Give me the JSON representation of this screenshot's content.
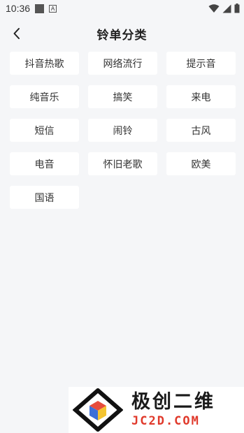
{
  "status": {
    "time": "10:36",
    "badge_letter": "A"
  },
  "header": {
    "title": "铃单分类",
    "back_icon": "chevron-left-icon"
  },
  "categories": [
    {
      "label": "抖音热歌"
    },
    {
      "label": "网络流行"
    },
    {
      "label": "提示音"
    },
    {
      "label": "纯音乐"
    },
    {
      "label": "搞笑"
    },
    {
      "label": "来电"
    },
    {
      "label": "短信"
    },
    {
      "label": "闹铃"
    },
    {
      "label": "古风"
    },
    {
      "label": "电音"
    },
    {
      "label": "怀旧老歌"
    },
    {
      "label": "欧美"
    },
    {
      "label": "国语"
    }
  ],
  "watermark": {
    "text_cn": "极创二维",
    "text_en": "JC2D.COM"
  },
  "colors": {
    "background": "#f5f6f8",
    "chip": "#ffffff",
    "text": "#333333",
    "brand_red": "#e0392b"
  }
}
